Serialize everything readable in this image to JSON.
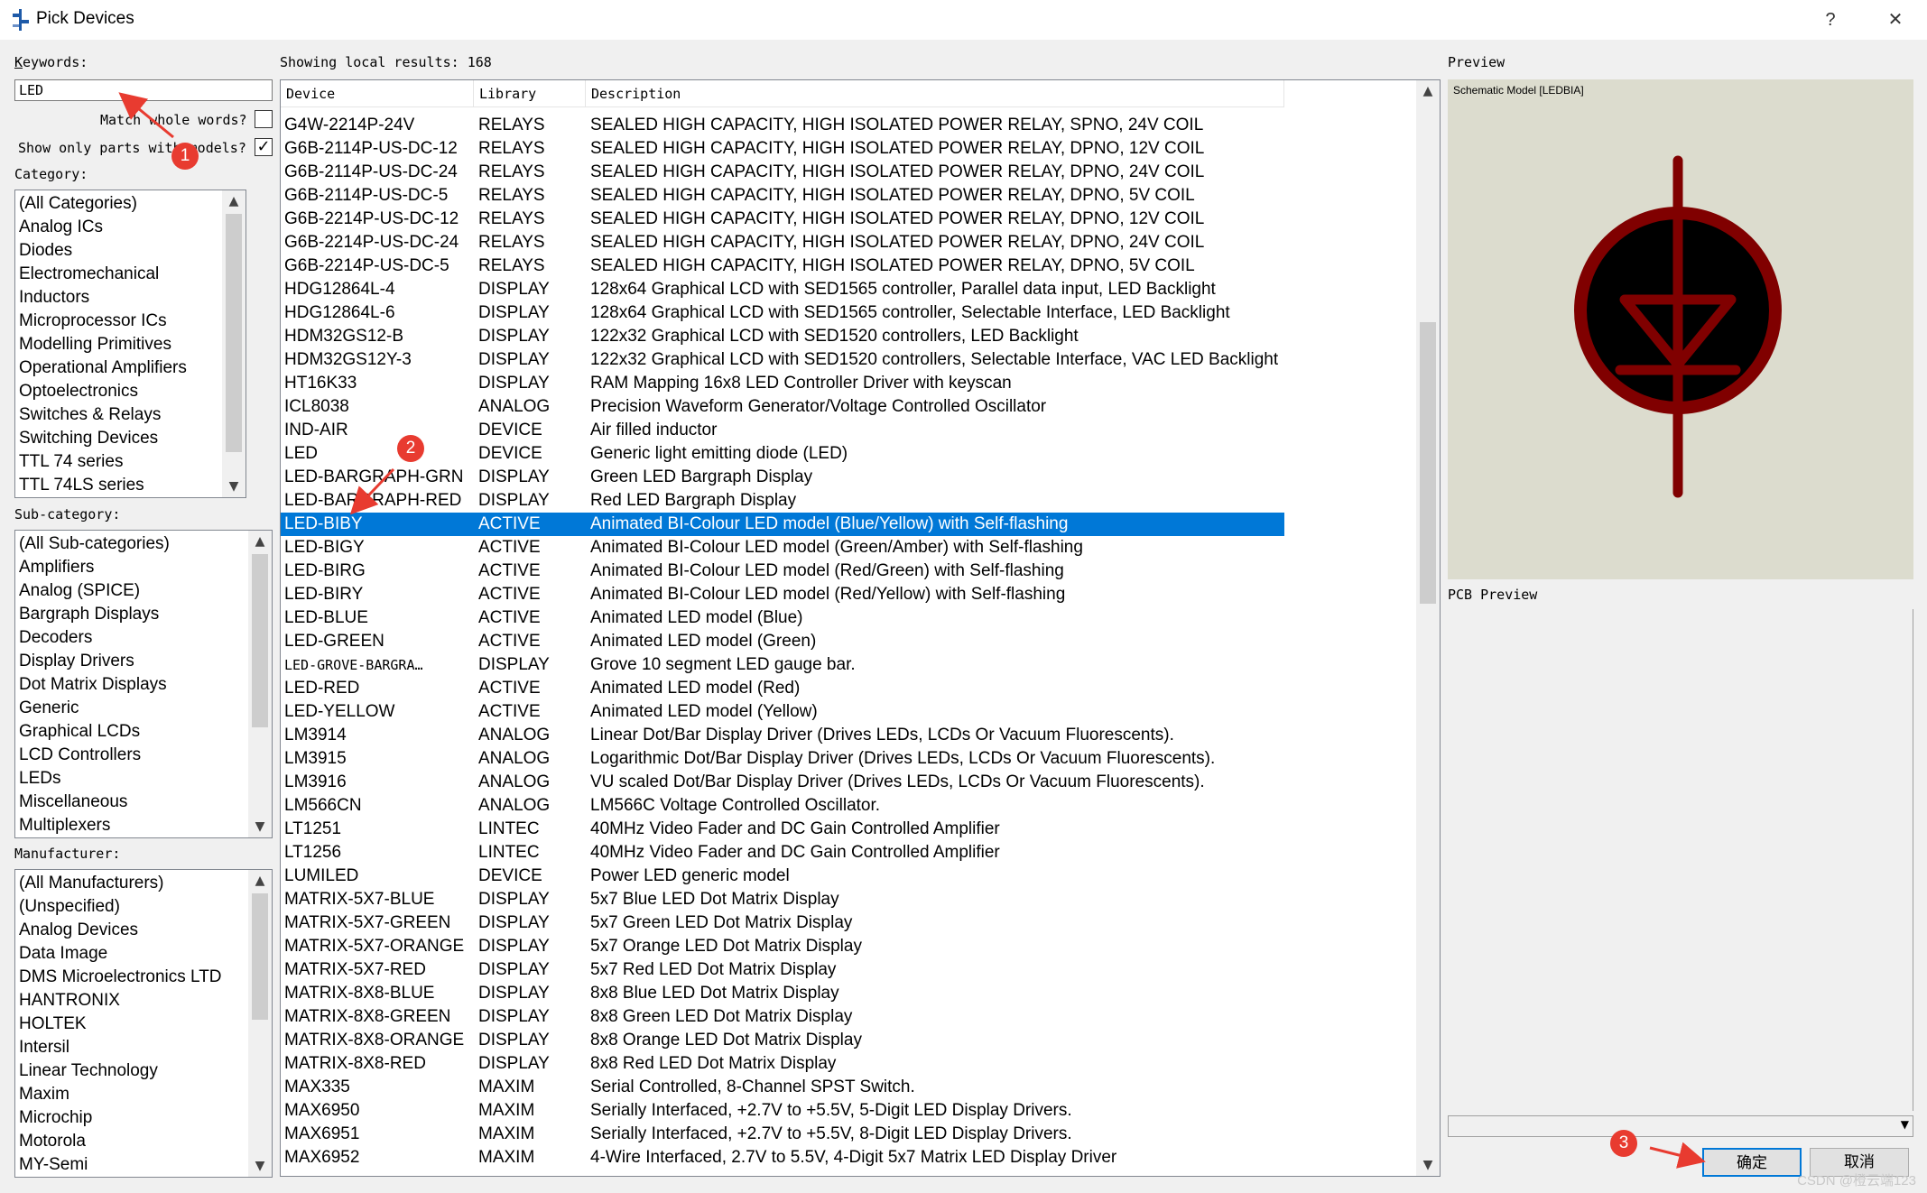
{
  "window": {
    "title": "Pick Devices",
    "help_label": "?",
    "close_label": "✕"
  },
  "left": {
    "keywords_label": "Keywords:",
    "keywords_value": "LED",
    "match_whole_label": "Match whole words?",
    "match_whole_checked": false,
    "show_models_label": "Show only parts with models?",
    "show_models_checked": true,
    "category_label": "Category:",
    "categories": [
      "(All Categories)",
      "Analog ICs",
      "Diodes",
      "Electromechanical",
      "Inductors",
      "Microprocessor ICs",
      "Modelling Primitives",
      "Operational Amplifiers",
      "Optoelectronics",
      "Switches & Relays",
      "Switching Devices",
      "TTL 74 series",
      "TTL 74LS series"
    ],
    "subcategory_label": "Sub-category:",
    "subcategories": [
      "(All Sub-categories)",
      "Amplifiers",
      "Analog (SPICE)",
      "Bargraph Displays",
      "Decoders",
      "Display Drivers",
      "Dot Matrix Displays",
      "Generic",
      "Graphical LCDs",
      "LCD Controllers",
      "LEDs",
      "Miscellaneous",
      "Multiplexers"
    ],
    "manufacturer_label": "Manufacturer:",
    "manufacturers": [
      "(All Manufacturers)",
      "(Unspecified)",
      "Analog Devices",
      "Data Image",
      "DMS Microelectronics LTD",
      "HANTRONIX",
      "HOLTEK",
      "Intersil",
      "Linear Technology",
      "Maxim",
      "Microchip",
      "Motorola",
      "MY-Semi"
    ]
  },
  "results": {
    "summary": "Showing local results: 168",
    "columns": [
      "Device",
      "Library",
      "Description"
    ],
    "rows": [
      [
        "G4W-2214P-24V",
        "RELAYS",
        "SEALED HIGH CAPACITY, HIGH ISOLATED POWER RELAY, SPNO, 24V COIL"
      ],
      [
        "G6B-2114P-US-DC-12",
        "RELAYS",
        "SEALED HIGH CAPACITY, HIGH ISOLATED POWER RELAY, DPNO, 12V COIL"
      ],
      [
        "G6B-2114P-US-DC-24",
        "RELAYS",
        "SEALED HIGH CAPACITY, HIGH ISOLATED POWER RELAY, DPNO, 24V COIL"
      ],
      [
        "G6B-2114P-US-DC-5",
        "RELAYS",
        "SEALED HIGH CAPACITY, HIGH ISOLATED POWER RELAY, DPNO, 5V COIL"
      ],
      [
        "G6B-2214P-US-DC-12",
        "RELAYS",
        "SEALED HIGH CAPACITY, HIGH ISOLATED POWER RELAY, DPNO, 12V COIL"
      ],
      [
        "G6B-2214P-US-DC-24",
        "RELAYS",
        "SEALED HIGH CAPACITY, HIGH ISOLATED POWER RELAY, DPNO, 24V COIL"
      ],
      [
        "G6B-2214P-US-DC-5",
        "RELAYS",
        "SEALED HIGH CAPACITY, HIGH ISOLATED POWER RELAY, DPNO, 5V COIL"
      ],
      [
        "HDG12864L-4",
        "DISPLAY",
        "128x64 Graphical LCD with SED1565 controller, Parallel data input, LED Backlight"
      ],
      [
        "HDG12864L-6",
        "DISPLAY",
        "128x64 Graphical LCD with SED1565 controller, Selectable Interface, LED Backlight"
      ],
      [
        "HDM32GS12-B",
        "DISPLAY",
        "122x32 Graphical LCD with SED1520 controllers, LED Backlight"
      ],
      [
        "HDM32GS12Y-3",
        "DISPLAY",
        "122x32 Graphical LCD with SED1520 controllers, Selectable Interface, VAC LED Backlight"
      ],
      [
        "HT16K33",
        "DISPLAY",
        "RAM Mapping 16x8 LED Controller Driver with keyscan"
      ],
      [
        "ICL8038",
        "ANALOG",
        "Precision Waveform Generator/Voltage Controlled Oscillator"
      ],
      [
        "IND-AIR",
        "DEVICE",
        "Air filled inductor"
      ],
      [
        "LED",
        "DEVICE",
        "Generic light emitting diode (LED)"
      ],
      [
        "LED-BARGRAPH-GRN",
        "DISPLAY",
        "Green LED Bargraph Display"
      ],
      [
        "LED-BARGRAPH-RED",
        "DISPLAY",
        "Red LED Bargraph Display"
      ],
      [
        "LED-BIBY",
        "ACTIVE",
        "Animated BI-Colour LED model (Blue/Yellow) with Self-flashing"
      ],
      [
        "LED-BIGY",
        "ACTIVE",
        "Animated BI-Colour LED model (Green/Amber) with Self-flashing"
      ],
      [
        "LED-BIRG",
        "ACTIVE",
        "Animated BI-Colour LED model (Red/Green) with Self-flashing"
      ],
      [
        "LED-BIRY",
        "ACTIVE",
        "Animated BI-Colour LED model (Red/Yellow) with Self-flashing"
      ],
      [
        "LED-BLUE",
        "ACTIVE",
        "Animated LED model (Blue)"
      ],
      [
        "LED-GREEN",
        "ACTIVE",
        "Animated LED model (Green)"
      ],
      [
        "LED-GROVE-BARGRA…",
        "DISPLAY",
        "Grove 10 segment LED gauge bar."
      ],
      [
        "LED-RED",
        "ACTIVE",
        "Animated LED model (Red)"
      ],
      [
        "LED-YELLOW",
        "ACTIVE",
        "Animated LED model (Yellow)"
      ],
      [
        "LM3914",
        "ANALOG",
        "Linear Dot/Bar Display Driver (Drives LEDs, LCDs Or Vacuum Fluorescents)."
      ],
      [
        "LM3915",
        "ANALOG",
        "Logarithmic Dot/Bar Display Driver (Drives LEDs, LCDs Or Vacuum Fluorescents)."
      ],
      [
        "LM3916",
        "ANALOG",
        "VU scaled Dot/Bar Display Driver (Drives LEDs, LCDs Or Vacuum Fluorescents)."
      ],
      [
        "LM566CN",
        "ANALOG",
        "LM566C Voltage Controlled Oscillator."
      ],
      [
        "LT1251",
        "LINTEC",
        "40MHz Video Fader and  DC Gain Controlled Amplifier"
      ],
      [
        "LT1256",
        "LINTEC",
        "40MHz Video Fader and  DC Gain Controlled Amplifier"
      ],
      [
        "LUMILED",
        "DEVICE",
        "Power LED generic model"
      ],
      [
        "MATRIX-5X7-BLUE",
        "DISPLAY",
        "5x7 Blue LED Dot Matrix Display"
      ],
      [
        "MATRIX-5X7-GREEN",
        "DISPLAY",
        "5x7 Green LED Dot Matrix Display"
      ],
      [
        "MATRIX-5X7-ORANGE",
        "DISPLAY",
        "5x7 Orange LED Dot Matrix Display"
      ],
      [
        "MATRIX-5X7-RED",
        "DISPLAY",
        "5x7 Red LED Dot Matrix Display"
      ],
      [
        "MATRIX-8X8-BLUE",
        "DISPLAY",
        "8x8 Blue LED Dot Matrix Display"
      ],
      [
        "MATRIX-8X8-GREEN",
        "DISPLAY",
        "8x8 Green LED Dot Matrix Display"
      ],
      [
        "MATRIX-8X8-ORANGE",
        "DISPLAY",
        "8x8 Orange LED Dot Matrix Display"
      ],
      [
        "MATRIX-8X8-RED",
        "DISPLAY",
        "8x8 Red LED Dot Matrix Display"
      ],
      [
        "MAX335",
        "MAXIM",
        "Serial Controlled, 8-Channel SPST Switch."
      ],
      [
        "MAX6950",
        "MAXIM",
        "Serially Interfaced, +2.7V to +5.5V, 5-Digit LED Display Drivers."
      ],
      [
        "MAX6951",
        "MAXIM",
        "Serially Interfaced, +2.7V to +5.5V, 8-Digit LED Display Drivers."
      ],
      [
        "MAX6952",
        "MAXIM",
        "4-Wire Interfaced, 2.7V to 5.5V, 4-Digit 5x7 Matrix LED Display Driver"
      ]
    ],
    "selected_device": "LED-BIBY"
  },
  "preview": {
    "label": "Preview",
    "caption": "Schematic Model [LEDBIA]",
    "pcb_label": "PCB Preview",
    "symbol_color": "#800000"
  },
  "buttons": {
    "ok": "确定",
    "cancel": "取消"
  },
  "annotations": [
    "1",
    "2",
    "3"
  ],
  "watermark": "CSDN @橙云端123",
  "colors": {
    "selection": "#0078d7",
    "annotation": "#e83b30"
  }
}
